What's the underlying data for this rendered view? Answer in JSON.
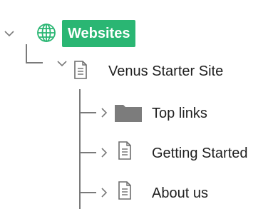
{
  "colors": {
    "selected_bg": "#2ab673",
    "tree_lines": "#7a7a7a",
    "icon_gray": "#6d6d6d",
    "folder": "#7c7c7c"
  },
  "tree": {
    "root": {
      "label": "Websites",
      "icon": "globe-icon",
      "expanded": true,
      "selected": true
    },
    "site": {
      "label": "Venus Starter Site",
      "icon": "page-icon",
      "expanded": true
    },
    "children": [
      {
        "label": "Top links",
        "icon": "folder-icon",
        "expanded": false
      },
      {
        "label": "Getting Started",
        "icon": "page-icon",
        "expanded": false
      },
      {
        "label": "About us",
        "icon": "page-icon",
        "expanded": false
      }
    ]
  }
}
